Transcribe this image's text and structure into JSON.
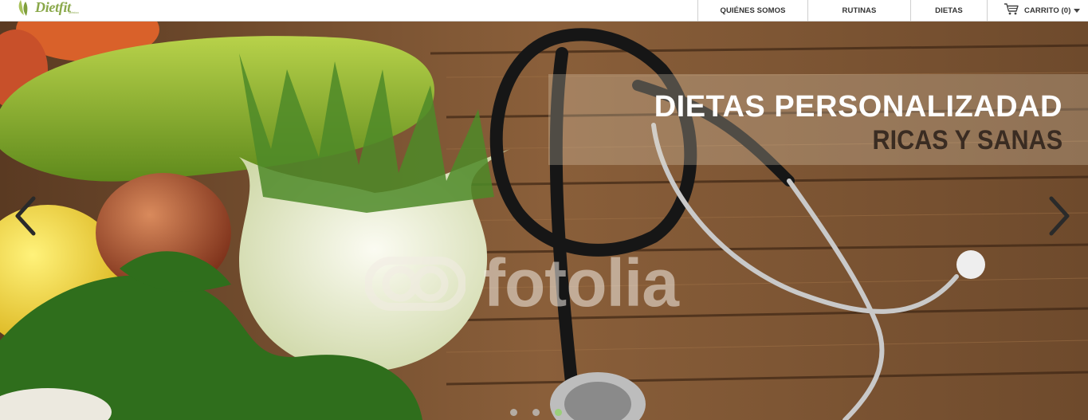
{
  "brand": {
    "name": "Dietfit",
    "tagline": "México"
  },
  "nav": {
    "items": [
      {
        "label": "QUIÉNES SOMOS"
      },
      {
        "label": "RUTINAS"
      },
      {
        "label": "DIETAS"
      }
    ],
    "cart_label": "CARRITO (0)"
  },
  "slider": {
    "title": "DIETAS PERSONALIZADAD",
    "subtitle": "RICAS Y SANAS",
    "watermark": "fotolia",
    "active_slide": 3,
    "slide_count": 3
  },
  "colors": {
    "logo_green": "#8aa84a",
    "caption_title": "#ffffff",
    "caption_subtitle": "#3a2c22",
    "active_dot": "#9bcf7a"
  },
  "icons": {
    "logo": "leaf-logo-icon",
    "cart": "shopping-cart-icon",
    "dropdown": "caret-down-icon",
    "prev": "chevron-left-icon",
    "next": "chevron-right-icon"
  }
}
